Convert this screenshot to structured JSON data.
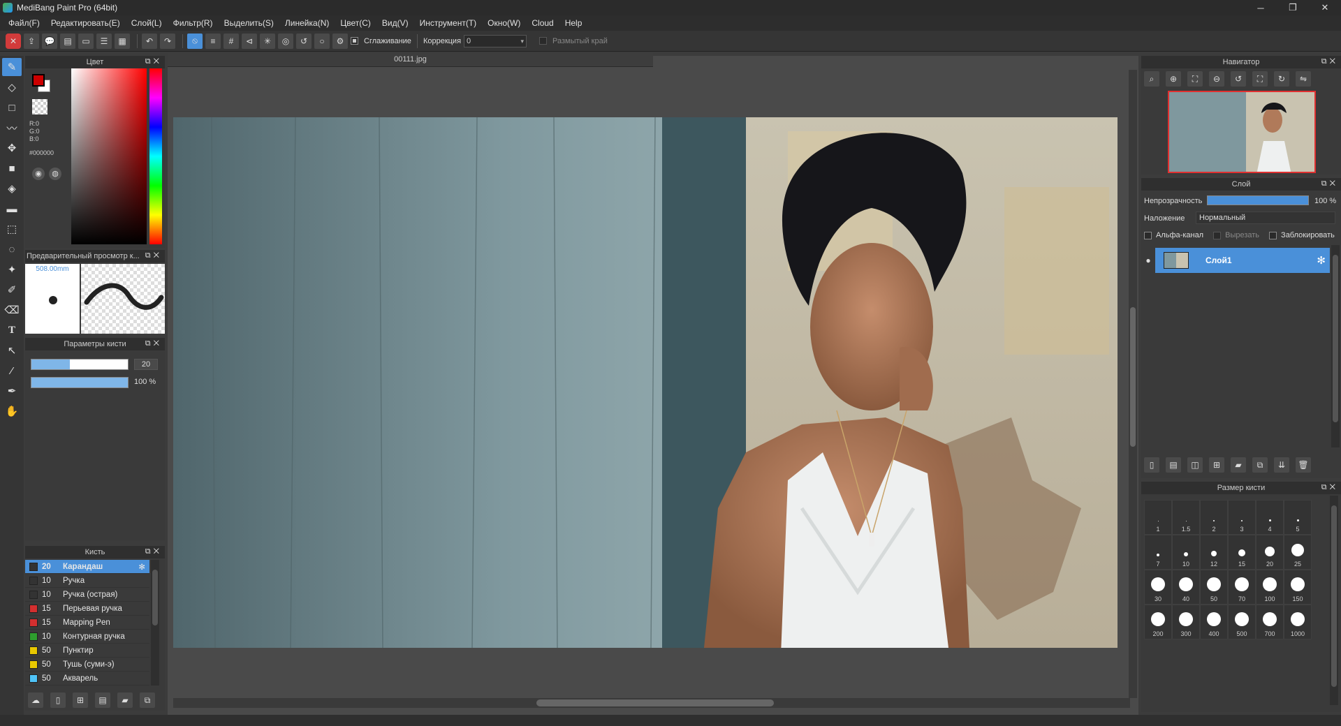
{
  "app": {
    "title": "MediBang Paint Pro (64bit)",
    "minimize": "─",
    "maximize": "❐",
    "close": "✕"
  },
  "menu": [
    "Файл(F)",
    "Редактировать(E)",
    "Слой(L)",
    "Фильтр(R)",
    "Выделить(S)",
    "Линейка(N)",
    "Цвет(C)",
    "Вид(V)",
    "Инструмент(T)",
    "Окно(W)",
    "Cloud",
    "Help"
  ],
  "toolbar": {
    "antialias_label": "Сглаживание",
    "correction_label": "Коррекция",
    "correction_value": "0",
    "blur_edge_label": "Размытый край"
  },
  "tab": {
    "filename": "00111.jpg"
  },
  "color_panel": {
    "title": "Цвет",
    "r": "R:0",
    "g": "G:0",
    "b": "B:0",
    "hex": "#000000",
    "primary": "#cc0000",
    "secondary": "#ffffff"
  },
  "brush_preview": {
    "title": "Предварительный просмотр к...",
    "size": "508.00mm"
  },
  "brush_params": {
    "title": "Параметры кисти",
    "size_value": "20",
    "opacity_value": "100 %",
    "size_fraction": 0.4,
    "opacity_fraction": 1.0
  },
  "brush_list": {
    "title": "Кисть",
    "items": [
      {
        "num": "20",
        "name": "Карандаш",
        "color": "#333333",
        "selected": true
      },
      {
        "num": "10",
        "name": "Ручка",
        "color": "#333333"
      },
      {
        "num": "10",
        "name": "Ручка (острая)",
        "color": "#333333"
      },
      {
        "num": "15",
        "name": "Перьевая ручка",
        "color": "#d32f2f"
      },
      {
        "num": "15",
        "name": "Mapping Pen",
        "color": "#d32f2f"
      },
      {
        "num": "10",
        "name": "Контурная ручка",
        "color": "#2e9e2e"
      },
      {
        "num": "50",
        "name": "Пунктир",
        "color": "#e8c800"
      },
      {
        "num": "50",
        "name": "Тушь (суми-э)",
        "color": "#e8c800"
      },
      {
        "num": "50",
        "name": "Акварель",
        "color": "#4fc3f7"
      }
    ]
  },
  "navigator": {
    "title": "Навигатор"
  },
  "layer_panel": {
    "title": "Слой",
    "opacity_label": "Непрозрачность",
    "opacity_value": "100 %",
    "opacity_fraction": 1.0,
    "blend_label": "Наложение",
    "blend_value": "Нормальный",
    "alpha_label": "Альфа-канал",
    "clip_label": "Вырезать",
    "lock_label": "Заблокировать",
    "layer_name": "Слой1"
  },
  "brush_size": {
    "title": "Размер кисти",
    "sizes": [
      "1",
      "1.5",
      "2",
      "3",
      "4",
      "5",
      "7",
      "10",
      "12",
      "15",
      "20",
      "25",
      "30",
      "40",
      "50",
      "70",
      "100",
      "150",
      "200",
      "300",
      "400",
      "500",
      "700",
      "1000"
    ]
  },
  "colors": {
    "accent": "#4a90d9",
    "bg": "#3c3c3c"
  }
}
